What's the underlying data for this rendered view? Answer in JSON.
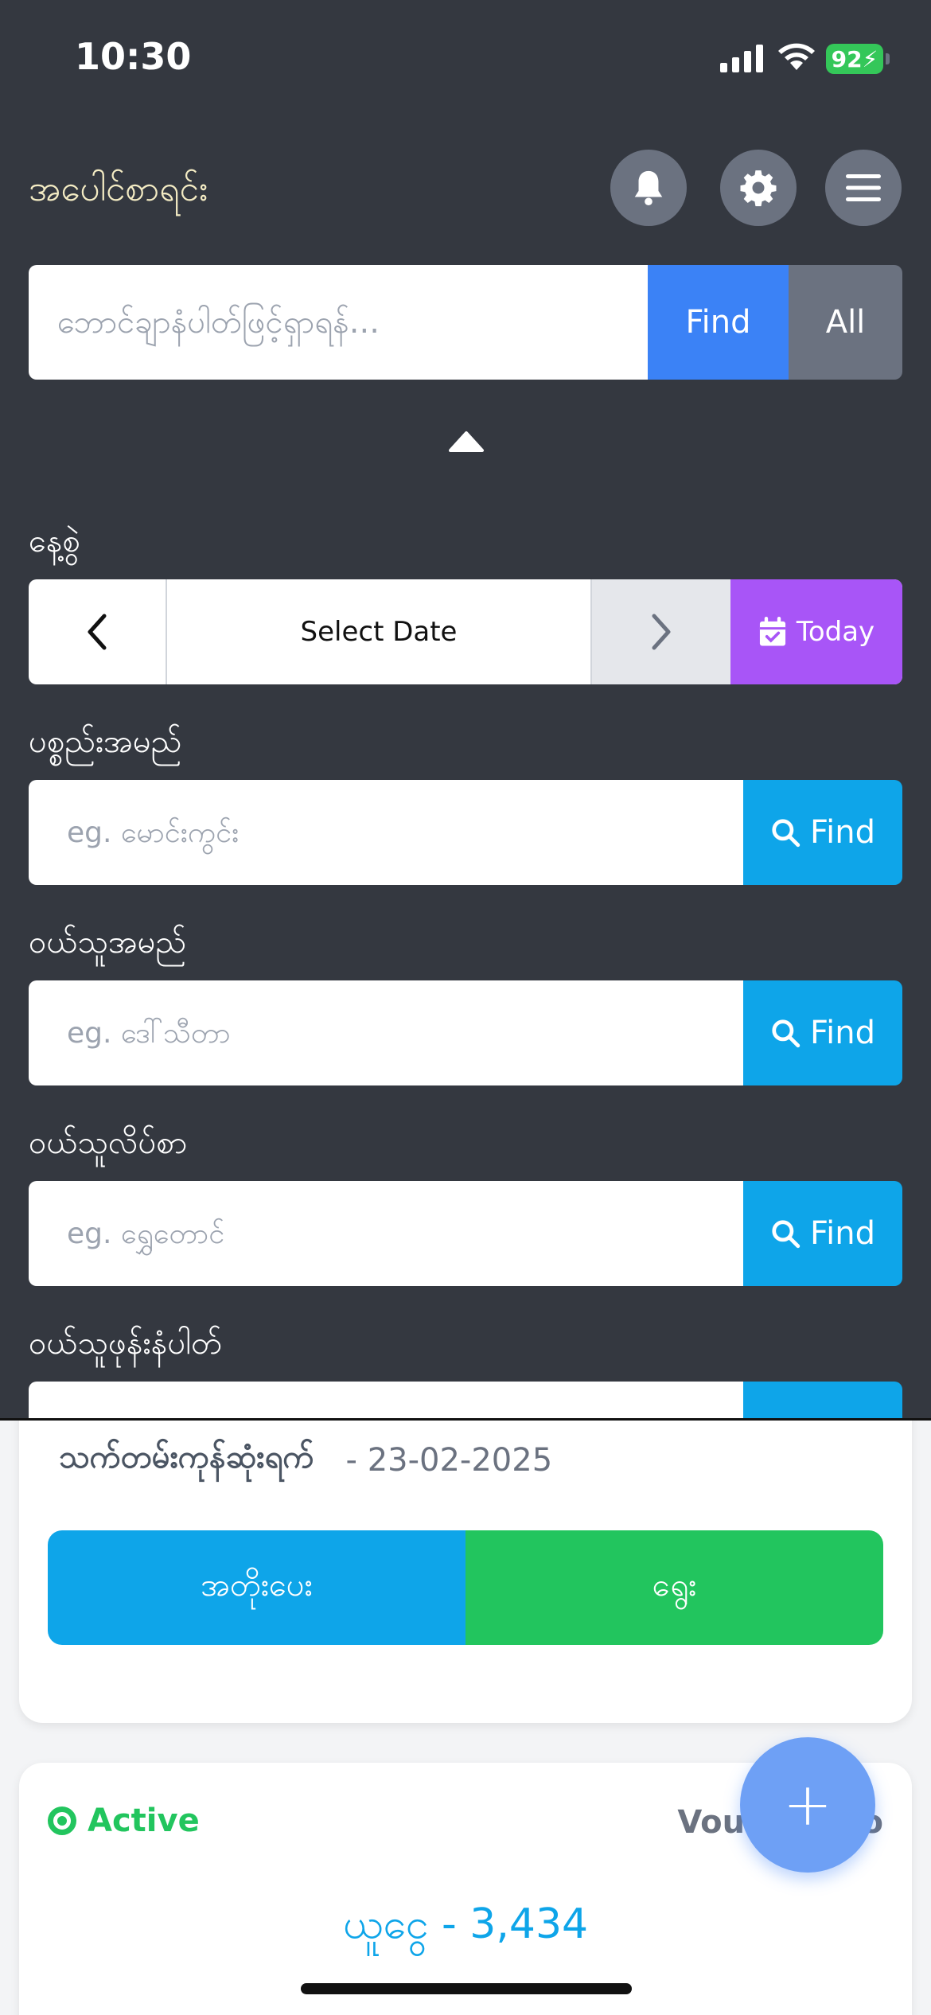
{
  "status_bar": {
    "time": "10:30",
    "battery": "92"
  },
  "header": {
    "title": "အပေါင်စာရင်း"
  },
  "search": {
    "placeholder": "ဘောင်ချာနံပါတ်ဖြင့်ရှာရန်...",
    "find_label": "Find",
    "all_label": "All"
  },
  "date_filter": {
    "label": "နေ့စွဲ",
    "select_label": "Select Date",
    "today_label": "Today"
  },
  "filters": [
    {
      "label": "ပစ္စည်းအမည်",
      "placeholder": "eg. မောင်းကွင်း",
      "button": "Find"
    },
    {
      "label": "ဝယ်သူအမည်",
      "placeholder": "eg. ဒေါ်သီတာ",
      "button": "Find"
    },
    {
      "label": "ဝယ်သူလိပ်စာ",
      "placeholder": "eg. ရွှေတောင်",
      "button": "Find"
    },
    {
      "label": "ဝယ်သူဖုန်းနံပါတ်"
    }
  ],
  "card1": {
    "expiry_label": "သက်တမ်းကုန်ဆုံးရက်",
    "expiry_value": "- 23-02-2025",
    "action_left": "အတိုးပေး",
    "action_right": "ရွေး"
  },
  "card2": {
    "status": "Active",
    "voucher_label": "Voucher No",
    "amount": "ယူငွေ - 3,434"
  },
  "fab": {
    "symbol": "+"
  },
  "colors": {
    "header_bg": "#343840",
    "find_blue": "#3b82f6",
    "filter_blue": "#0ea5e9",
    "today_purple": "#a855f7",
    "active_green": "#22c55e",
    "title_cream": "#f4ecc4"
  },
  "icons": {
    "notification": "bell-icon",
    "settings": "gear-icon",
    "menu": "hamburger-icon",
    "collapse": "caret-up-icon",
    "prev": "chevron-left-icon",
    "next": "chevron-right-icon",
    "today": "calendar-check-icon",
    "search": "search-icon",
    "add": "plus-icon"
  }
}
